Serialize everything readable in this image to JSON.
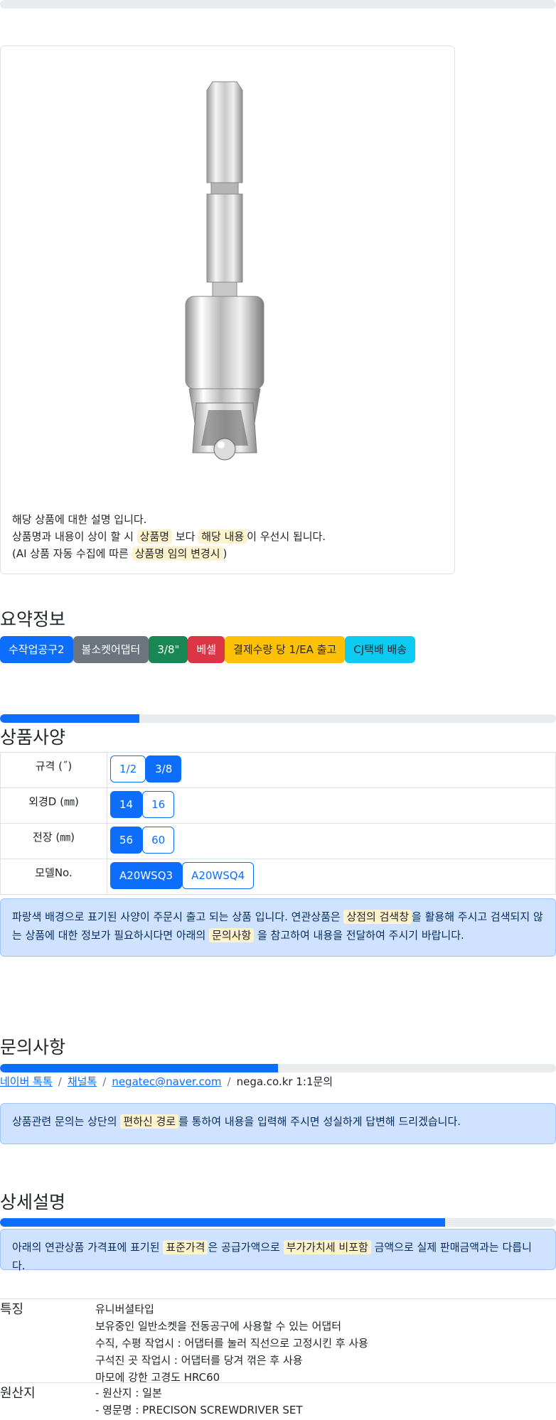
{
  "top_progress": {
    "value": 0
  },
  "product_card": {
    "image_icon": "hex-shank-socket-adapter-image",
    "desc_line1": "해당 상품에 대한 설명 입니다.",
    "desc_line2_pre": "상품명과 내용이 상이 할 시 ",
    "desc_line2_mark1": "상품명",
    "desc_line2_mid": " 보다 ",
    "desc_line2_mark2": "해당 내용",
    "desc_line2_post": "이 우선시 됩니다.",
    "desc_line3_pre": "(AI 상품 자동 수집에 따른 ",
    "desc_line3_mark": "상품명 임의 변경시",
    "desc_line3_post": ")"
  },
  "summary": {
    "title": "요약정보",
    "badges": [
      {
        "label": "수작업공구2",
        "color": "#0d6efd"
      },
      {
        "label": "볼소켓어댑터",
        "color": "#6c757d"
      },
      {
        "label": "3/8\"",
        "color": "#198754"
      },
      {
        "label": "베셀",
        "color": "#dc3545"
      },
      {
        "label": "결제수량 당 1/EA 출고",
        "color": "#ffc107"
      },
      {
        "label": "CJ택배 배송",
        "color": "#0dcaf0"
      }
    ]
  },
  "spec": {
    "progress": 0.25,
    "title": "상품사양",
    "rows": [
      {
        "label": "규격 (˝)",
        "options": [
          {
            "label": "1/2",
            "selected": false
          },
          {
            "label": "3/8",
            "selected": true
          }
        ]
      },
      {
        "label": "외경D (㎜)",
        "options": [
          {
            "label": "14",
            "selected": true
          },
          {
            "label": "16",
            "selected": false
          }
        ]
      },
      {
        "label": "전장 (㎜)",
        "options": [
          {
            "label": "56",
            "selected": true
          },
          {
            "label": "60",
            "selected": false
          }
        ]
      },
      {
        "label": "모델No.",
        "options": [
          {
            "label": "A20WSQ3",
            "selected": true
          },
          {
            "label": "A20WSQ4",
            "selected": false
          }
        ]
      }
    ],
    "alert_pre": "파랑색 배경으로 표기된 사양이 주문시 출고 되는 상품 입니다. 연관상품은 ",
    "alert_mark1": "상점의 검색창",
    "alert_mid": "을 활용해 주시고 검색되지 않는 상품에 대한 정보가 필요하시다면 아래의 ",
    "alert_mark2": "문의사항",
    "alert_post": " 을 참고하여 내용을 전달하여 주시기 바랍니다."
  },
  "inquiry": {
    "title": "문의사항",
    "progress": 0.5,
    "link1": "네이버 톡톡",
    "link2": "채널톡",
    "link3": "negatec@naver.com",
    "plain": "nega.co.kr 1:1문의",
    "sep": "/",
    "alert_pre": "상품관련 문의는 상단의 ",
    "alert_mark": "편하신 경로",
    "alert_post": "를 통하여 내용을 입력해 주시면 성실하게 답변해 드리겠습니다."
  },
  "details": {
    "title": "상세설명",
    "progress": 0.8,
    "alert_pre": "아래의 연관상품 가격표에 표기된 ",
    "alert_mark1": "표준가격",
    "alert_mid": "은 공급가액으로 ",
    "alert_mark2": "부가가치세 비포함",
    "alert_post": " 금액으로 실제 판매금액과는 다릅니다.",
    "features_label": "특징",
    "features": [
      "유니버셜타입",
      "보유중인 일반소켓을 전동공구에 사용할 수 있는 어댑터",
      "수직, 수평 작업시 : 어댑터를 눌러 직선으로 고정시킨 후 사용",
      "구석진 곳 작업시 : 어댑터를 당겨 꺾은 후 사용",
      "마모에 강한 고경도 HRC60"
    ],
    "origin_label": "원산지",
    "origin": [
      "- 원산지 : 일본",
      "- 영문명 : PRECISON SCREWDRIVER SET"
    ]
  }
}
